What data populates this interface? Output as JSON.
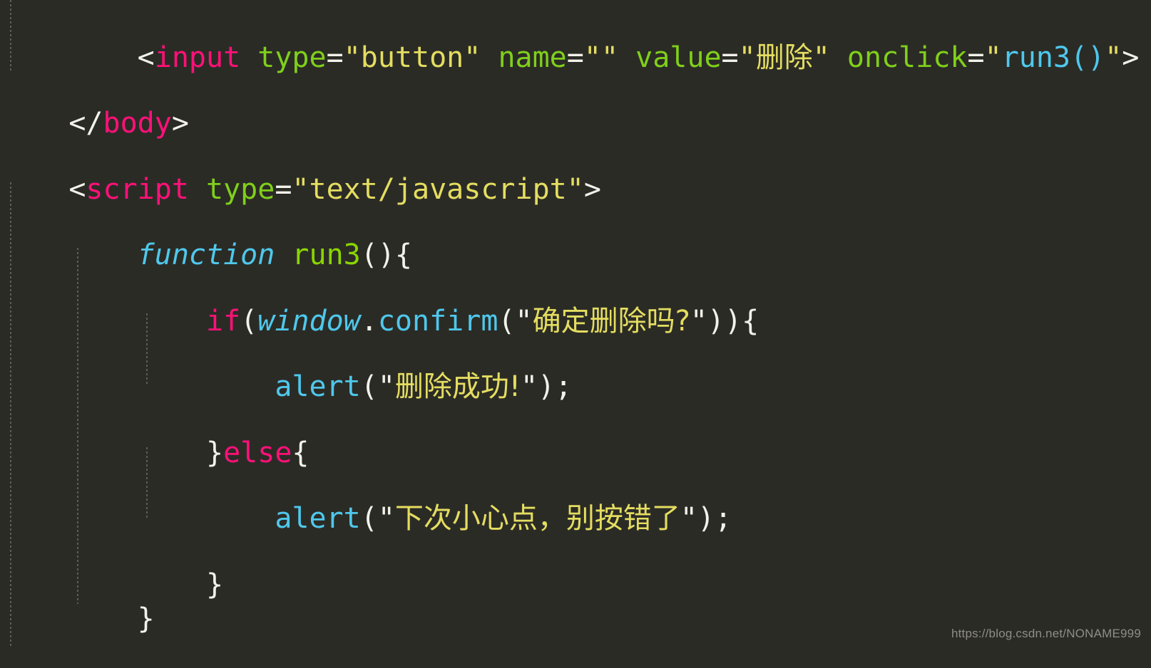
{
  "editor": {
    "background_color": "#2b2b26",
    "font_size_px": 40,
    "theme_colors": {
      "punctuation": "#f2f2ea",
      "tag": "#ff1178",
      "keyword": "#ff1178",
      "attribute": "#7fd01a",
      "string": "#e4dd60",
      "function": "#4fc8ec",
      "identifier_italic": "#4fc8ec",
      "method_green": "#89d600",
      "indent_guide": "#6d6d63"
    }
  },
  "code": {
    "line1": {
      "indent": "    ",
      "open_bracket": "<",
      "tag_name": "input",
      "space1": " ",
      "attr_type": "type",
      "eq1": "=",
      "val_type": "\"button\"",
      "space2": " ",
      "attr_name": "name",
      "eq2": "=",
      "val_name": "\"\"",
      "space3": " ",
      "attr_value": "value",
      "eq3": "=",
      "val_value_open": "\"",
      "val_value_text": "删除",
      "val_value_close": "\"",
      "space4": " ",
      "attr_onclick": "onclick",
      "eq4": "=",
      "quote_open": "\"",
      "handler": "run3()",
      "quote_close": "\"",
      "close_bracket": ">"
    },
    "line2": {
      "open": "</",
      "tag_name": "body",
      "close": ">"
    },
    "line3": {
      "open_bracket": "<",
      "tag_name": "script",
      "space": " ",
      "attr_type": "type",
      "eq": "=",
      "val_type": "\"text/javascript\"",
      "close_bracket": ">"
    },
    "line4": {
      "indent": "    ",
      "keyword": "function",
      "space": " ",
      "fn_name": "run3",
      "parens": "(){"
    },
    "line5": {
      "indent": "        ",
      "keyword": "if",
      "paren_open": "(",
      "object": "window",
      "dot": ".",
      "method": "confirm",
      "call_open": "(\"",
      "string_text": "确定删除吗?",
      "call_close": "\")){"
    },
    "line6": {
      "indent": "            ",
      "fn_name": "alert",
      "call_open": "(\"",
      "string_text": "删除成功!",
      "call_close": "\");"
    },
    "line7": {
      "indent": "        ",
      "brace_close": "}",
      "keyword": "else",
      "brace_open": "{"
    },
    "line8": {
      "indent": "            ",
      "fn_name": "alert",
      "call_open": "(\"",
      "string_text": "下次小心点，别按错了",
      "call_close": "\");"
    },
    "line9": {
      "indent": "        ",
      "brace": "}"
    },
    "line10": {
      "indent": "    ",
      "brace": "}"
    }
  },
  "watermark": {
    "text": "https://blog.csdn.net/NONAME999"
  }
}
